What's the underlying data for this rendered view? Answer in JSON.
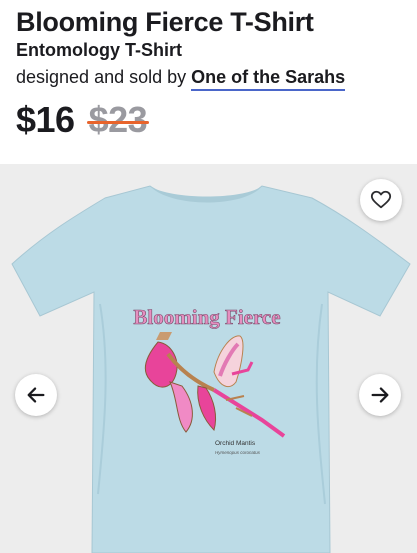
{
  "product": {
    "title": "Blooming Fierce T-Shirt",
    "subtitle": "Entomology T-Shirt",
    "seller_prefix": "designed and sold by ",
    "seller_name": "One of the Sarahs",
    "price": "$16",
    "original_price": "$23"
  },
  "design": {
    "headline": "Blooming Fierce",
    "caption_title": "Orchid Mantis",
    "caption_latin": "Hymenopus coronatus"
  },
  "icons": {
    "favorite": "heart-outline-icon",
    "previous": "arrow-left-icon",
    "next": "arrow-right-icon"
  },
  "colors": {
    "shirt": "#bcdbe6",
    "sale_strike": "#e8642c",
    "seller_underline": "#4a66c9",
    "design_pink": "#e68fc0"
  }
}
